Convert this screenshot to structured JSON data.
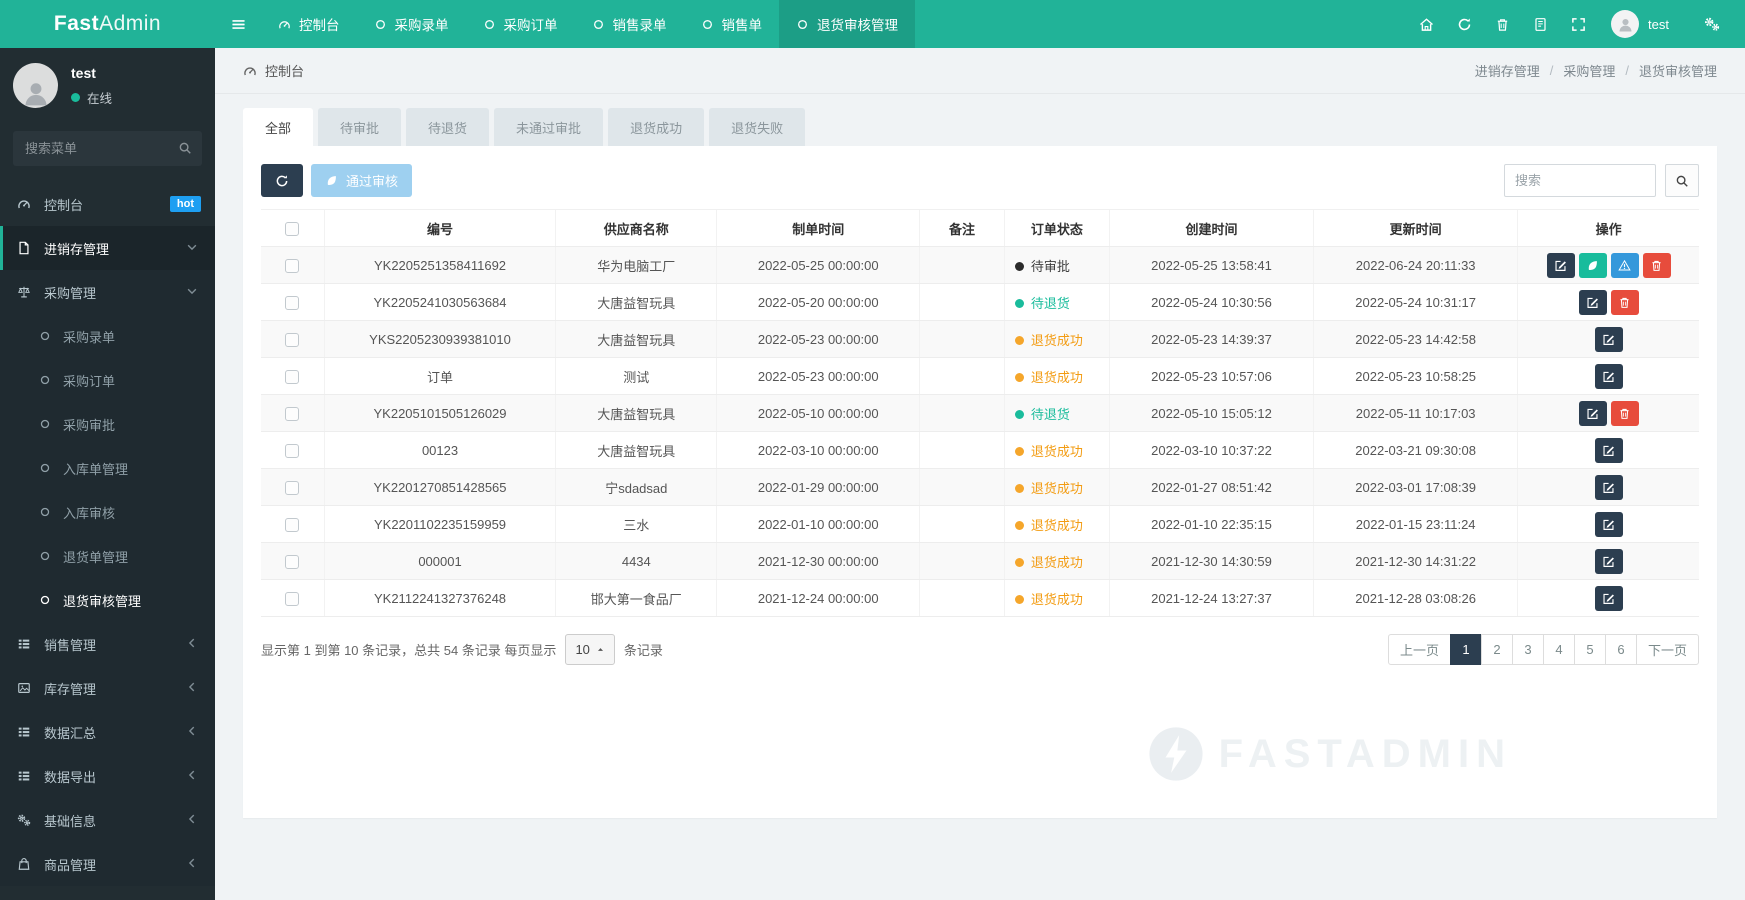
{
  "topbar": {
    "logo": {
      "bold": "Fast",
      "light": "Admin"
    },
    "tabs": [
      {
        "key": "console",
        "label": "控制台",
        "icon": "dashboard",
        "active": false
      },
      {
        "key": "purchase-entry",
        "label": "采购录单",
        "icon": "circle",
        "active": false
      },
      {
        "key": "purchase-order",
        "label": "采购订单",
        "icon": "circle",
        "active": false
      },
      {
        "key": "sales-entry",
        "label": "销售录单",
        "icon": "circle",
        "active": false
      },
      {
        "key": "sales-order",
        "label": "销售单",
        "icon": "circle",
        "active": false
      },
      {
        "key": "return-audit",
        "label": "退货审核管理",
        "icon": "circle",
        "active": true
      }
    ],
    "right_icons": [
      "home",
      "refresh",
      "trash",
      "docs",
      "fullscreen"
    ],
    "user": "test"
  },
  "sidebar": {
    "user": {
      "name": "test",
      "status": "在线"
    },
    "search_placeholder": "搜索菜单",
    "menu": [
      {
        "key": "console",
        "label": "控制台",
        "icon": "dashboard",
        "badge": "hot"
      },
      {
        "key": "invoicing",
        "label": "进销存管理",
        "icon": "file",
        "chevron": "down",
        "trail": true
      },
      {
        "key": "purchase",
        "label": "采购管理",
        "icon": "scale",
        "chevron": "down",
        "region": true
      },
      {
        "key": "purchase-entry",
        "label": "采购录单",
        "icon": "circle",
        "child": true,
        "region": true
      },
      {
        "key": "purchase-order",
        "label": "采购订单",
        "icon": "circle",
        "child": true,
        "region": true
      },
      {
        "key": "purchase-audit",
        "label": "采购审批",
        "icon": "circle",
        "child": true,
        "region": true
      },
      {
        "key": "inbound-mgmt",
        "label": "入库单管理",
        "icon": "circle",
        "child": true,
        "region": true
      },
      {
        "key": "inbound-audit",
        "label": "入库审核",
        "icon": "circle",
        "child": true,
        "region": true
      },
      {
        "key": "return-mgmt",
        "label": "退货单管理",
        "icon": "circle",
        "child": true,
        "region": true
      },
      {
        "key": "return-audit",
        "label": "退货审核管理",
        "icon": "circle",
        "child": true,
        "active": true,
        "region": true
      },
      {
        "key": "sales",
        "label": "销售管理",
        "icon": "list",
        "chevron": "left",
        "region": true
      },
      {
        "key": "inventory",
        "label": "库存管理",
        "icon": "image",
        "chevron": "left",
        "region": true
      },
      {
        "key": "data-summary",
        "label": "数据汇总",
        "icon": "list",
        "chevron": "left",
        "region": true
      },
      {
        "key": "data-export",
        "label": "数据导出",
        "icon": "list",
        "chevron": "left",
        "region": true
      },
      {
        "key": "base-info",
        "label": "基础信息",
        "icon": "cogs",
        "chevron": "left",
        "region": true
      },
      {
        "key": "goods",
        "label": "商品管理",
        "icon": "bag",
        "chevron": "left",
        "region": true
      }
    ]
  },
  "breadcrumb": {
    "left": "控制台",
    "trail": [
      "进销存管理",
      "采购管理",
      "退货审核管理"
    ]
  },
  "filter_tabs": [
    {
      "label": "全部",
      "active": true
    },
    {
      "label": "待审批",
      "active": false
    },
    {
      "label": "待退货",
      "active": false
    },
    {
      "label": "未通过审批",
      "active": false
    },
    {
      "label": "退货成功",
      "active": false
    },
    {
      "label": "退货失败",
      "active": false
    }
  ],
  "toolbar": {
    "approve_label": "通过审核",
    "search_placeholder": "搜索"
  },
  "table": {
    "columns": [
      "编号",
      "供应商名称",
      "制单时间",
      "备注",
      "订单状态",
      "创建时间",
      "更新时间",
      "操作"
    ],
    "rows": [
      {
        "code": "YK2205251358411692",
        "supplier": "华为电脑工厂",
        "order_time": "2022-05-25 00:00:00",
        "remark": "",
        "status": "待审批",
        "status_class": "dark",
        "created": "2022-05-25 13:58:41",
        "updated": "2022-06-24 20:11:33",
        "actions": [
          "edit",
          "approve",
          "warn",
          "del"
        ]
      },
      {
        "code": "YK2205241030563684",
        "supplier": "大唐益智玩具",
        "order_time": "2022-05-20 00:00:00",
        "remark": "",
        "status": "待退货",
        "status_class": "green",
        "created": "2022-05-24 10:30:56",
        "updated": "2022-05-24 10:31:17",
        "actions": [
          "edit",
          "del"
        ]
      },
      {
        "code": "YKS2205230939381010",
        "supplier": "大唐益智玩具",
        "order_time": "2022-05-23 00:00:00",
        "remark": "",
        "status": "退货成功",
        "status_class": "orange",
        "created": "2022-05-23 14:39:37",
        "updated": "2022-05-23 14:42:58",
        "actions": [
          "edit"
        ]
      },
      {
        "code": "订单",
        "supplier": "测试",
        "order_time": "2022-05-23 00:00:00",
        "remark": "",
        "status": "退货成功",
        "status_class": "orange",
        "created": "2022-05-23 10:57:06",
        "updated": "2022-05-23 10:58:25",
        "actions": [
          "edit"
        ]
      },
      {
        "code": "YK2205101505126029",
        "supplier": "大唐益智玩具",
        "order_time": "2022-05-10 00:00:00",
        "remark": "",
        "status": "待退货",
        "status_class": "green",
        "created": "2022-05-10 15:05:12",
        "updated": "2022-05-11 10:17:03",
        "actions": [
          "edit",
          "del"
        ]
      },
      {
        "code": "00123",
        "supplier": "大唐益智玩具",
        "order_time": "2022-03-10 00:00:00",
        "remark": "",
        "status": "退货成功",
        "status_class": "orange",
        "created": "2022-03-10 10:37:22",
        "updated": "2022-03-21 09:30:08",
        "actions": [
          "edit"
        ]
      },
      {
        "code": "YK2201270851428565",
        "supplier": "宁sdadsad",
        "order_time": "2022-01-29 00:00:00",
        "remark": "",
        "status": "退货成功",
        "status_class": "orange",
        "created": "2022-01-27 08:51:42",
        "updated": "2022-03-01 17:08:39",
        "actions": [
          "edit"
        ]
      },
      {
        "code": "YK2201102235159959",
        "supplier": "三水",
        "order_time": "2022-01-10 00:00:00",
        "remark": "",
        "status": "退货成功",
        "status_class": "orange",
        "created": "2022-01-10 22:35:15",
        "updated": "2022-01-15 23:11:24",
        "actions": [
          "edit"
        ]
      },
      {
        "code": "000001",
        "supplier": "4434",
        "order_time": "2021-12-30 00:00:00",
        "remark": "",
        "status": "退货成功",
        "status_class": "orange",
        "created": "2021-12-30 14:30:59",
        "updated": "2021-12-30 14:31:22",
        "actions": [
          "edit"
        ]
      },
      {
        "code": "YK2112241327376248",
        "supplier": "邯大第一食品厂",
        "order_time": "2021-12-24 00:00:00",
        "remark": "",
        "status": "退货成功",
        "status_class": "orange",
        "created": "2021-12-24 13:27:37",
        "updated": "2021-12-28 03:08:26",
        "actions": [
          "edit"
        ]
      }
    ]
  },
  "footer": {
    "summary_prefix": "显示第 1 到第 10 条记录，总共 54 条记录 每页显示",
    "per_page": "10",
    "summary_suffix": "条记录",
    "pagination": {
      "prev_label": "上一页",
      "pages": [
        "1",
        "2",
        "3",
        "4",
        "5",
        "6"
      ],
      "active": "1",
      "next_label": "下一页"
    }
  },
  "watermark": {
    "text": "FASTADMIN"
  },
  "colors": {
    "topbar": "#21b398",
    "topbar_active": "#1c9e86",
    "sidebar": "#222d32",
    "hot_badge": "#1e9ff2",
    "online_dot": "#1abc9c",
    "status_pending": "#2b2b2b",
    "status_waiting_return": "#1abc9c",
    "status_success": "#f39c12",
    "btn_edit": "#2c3e50",
    "btn_approve": "#18bc9c",
    "btn_warn": "#3498db",
    "btn_delete": "#e74c3c",
    "pagination_active": "#2c3e50"
  }
}
